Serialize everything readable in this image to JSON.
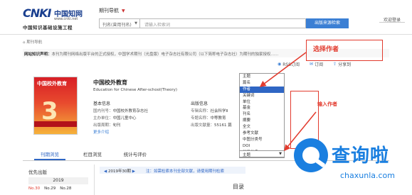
{
  "header": {
    "logo_mark": "CNKI",
    "logo_cn": "中国知网",
    "logo_url": "www.cnki.net",
    "logo_subtitle": "中国知识基础设施工程",
    "nav_dropdown": "期刊导航",
    "search_field": "刊名(曾用刊名)",
    "search_placeholder": "请输入检索词",
    "search_button": "出版来源检索",
    "login_link": "欢迎登录"
  },
  "breadcrumb": "期刊导航",
  "notice": {
    "label": "网站知识声明：",
    "text": "本刊为期刊网络出版平台的正式授权，中国学术期刊（光盘版）电子杂志社有限公司（以下简称电子杂志社）为期刊的独家授权……"
  },
  "toolbar": [
    {
      "icon": "rss-icon",
      "label": "RSS订阅"
    },
    {
      "icon": "mail-icon",
      "label": "订阅"
    },
    {
      "icon": "share-icon",
      "label": "分享到"
    }
  ],
  "journal": {
    "cover_title": "中国校外教育",
    "cover_badge": "3",
    "title": "中国校外教育",
    "title_en": "Education for Chinese After-school(Theory)",
    "basic_heading": "基本信息",
    "pub_heading": "出版信息",
    "basic_info": [
      {
        "key": "国内刊号：",
        "value": "中国校外教育杂志社"
      },
      {
        "key": "主办单位：",
        "value": "中国儿童中心"
      },
      {
        "key": "出版周期：",
        "value": "旬刊"
      }
    ],
    "pub_info": [
      {
        "key": "专辑名称：",
        "value": "社会科学Ⅱ"
      },
      {
        "key": "专题名称：",
        "value": "中等教育"
      },
      {
        "key": "出版文献量：",
        "value": "55161 篇"
      }
    ],
    "more_link": "更多介绍"
  },
  "field_list": {
    "options": [
      "主题",
      "篇名",
      "作者",
      "关键词",
      "单位",
      "基金",
      "刊名",
      "摘要",
      "全文",
      "参考文献",
      "中图分类号",
      "DOI",
      "栏目信息"
    ],
    "selected_index": 2,
    "current_value": "主题"
  },
  "annotations": {
    "select_author": "选择作者",
    "input_author": "输入作者"
  },
  "tabs": [
    {
      "label": "刊期浏览",
      "active": true
    },
    {
      "label": "栏目浏览",
      "active": false
    },
    {
      "label": "统计与评价",
      "active": false
    }
  ],
  "issues": {
    "label": "优先出版",
    "year": "2019",
    "numbers": [
      {
        "label": "No.30",
        "current": true
      },
      {
        "label": "No.29",
        "current": false
      },
      {
        "label": "No.28",
        "current": false
      }
    ]
  },
  "issue_nav": {
    "current": "2019年30期",
    "note": "注：如需检索本刊全部文献，请使用期刊检索"
  },
  "toc_title": "目录",
  "watermark": {
    "text": "查询啦",
    "url": "chaxunla.com"
  },
  "colors": {
    "brand_blue": "#1a3f8f",
    "accent_blue": "#3b7fd4",
    "selection_blue": "#2f66c4",
    "annotation_red": "#e23b2e",
    "watermark_blue": "#1a7fe0"
  }
}
